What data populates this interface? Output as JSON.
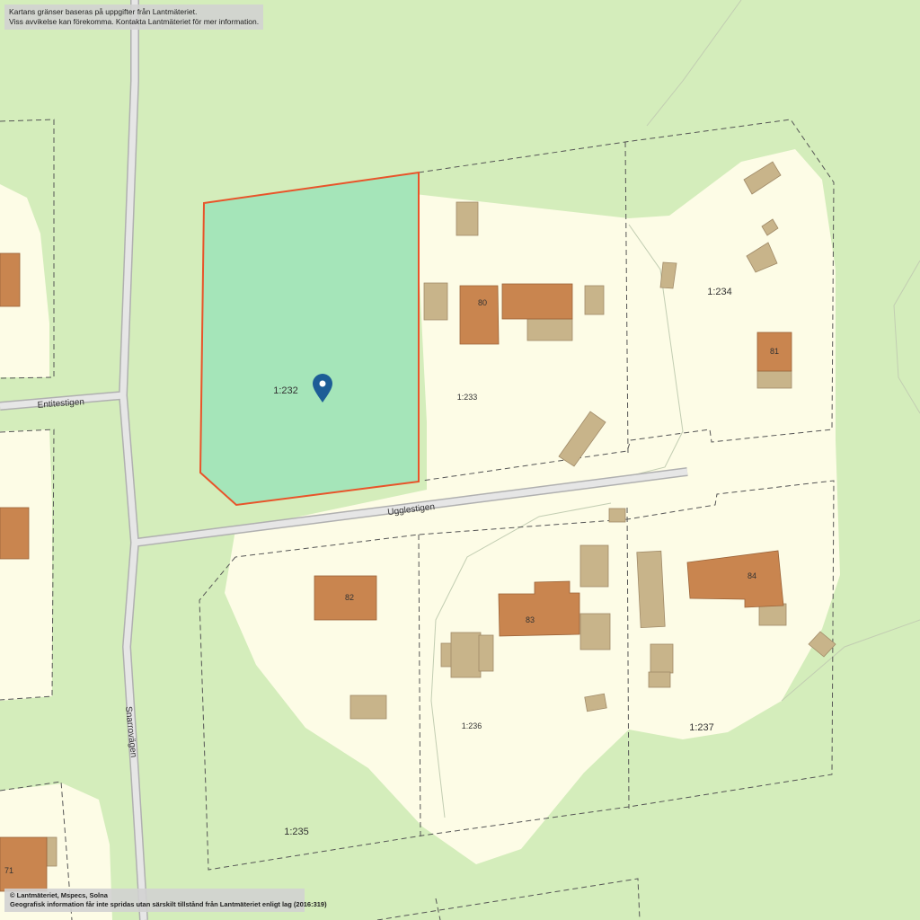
{
  "notices": {
    "top_line1": "Kartans gränser baseras på uppgifter från Lantmäteriet.",
    "top_line2": "Viss avvikelse kan förekomma. Kontakta Lantmäteriet för mer information.",
    "bottom_line1": "© Lantmäteriet, Mspecs, Solna",
    "bottom_line2": "Geografisk information får inte spridas utan särskilt tillstånd från Lantmäteriet enligt lag (2016:319)"
  },
  "streets": {
    "entitestigen": "Entitestigen",
    "ugglestigen": "Ugglestigen",
    "snarrovagen": "Snarrovägen"
  },
  "parcels": {
    "selected": "1:232",
    "p233": "1:233",
    "p234": "1:234",
    "p235": "1:235",
    "p236": "1:236",
    "p237": "1:237"
  },
  "buildings": {
    "b71": "71",
    "b80": "80",
    "b81": "81",
    "b82": "82",
    "b83": "83",
    "b84": "84"
  },
  "colors": {
    "background_green": "#d4edbb",
    "residential": "#fdfce6",
    "selected_fill": "#a5e5b9",
    "selected_border": "#e8542a",
    "house": "#c9854f",
    "outbuilding": "#c8b48a",
    "marker": "#1d5d96"
  },
  "icons": {
    "marker": "map-pin-icon"
  }
}
